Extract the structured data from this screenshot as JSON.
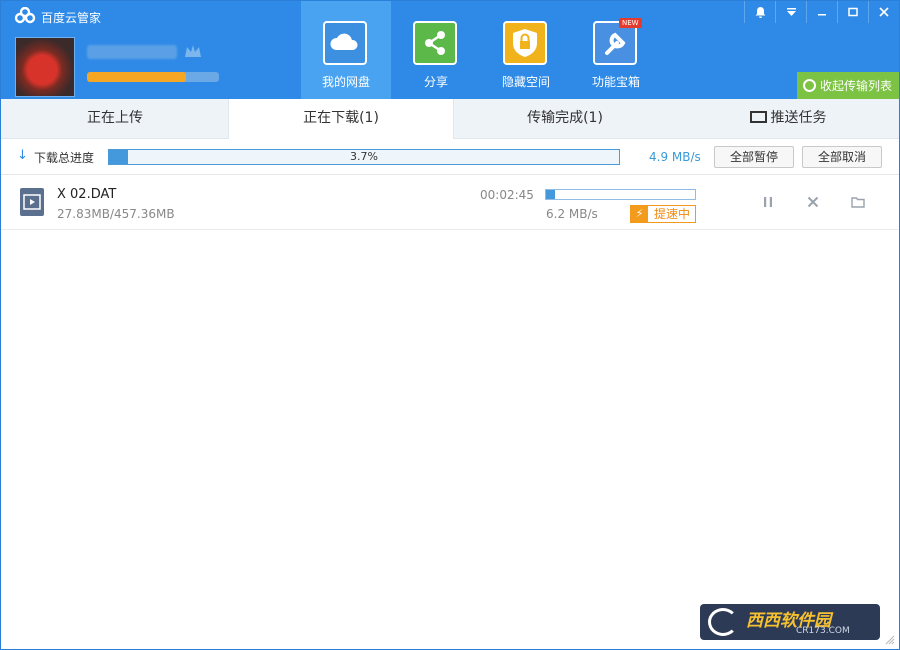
{
  "app": {
    "title": "百度云管家"
  },
  "user": {
    "level_progress": 0.75
  },
  "nav": [
    {
      "label": "我的网盘",
      "icon": "cloud-icon",
      "active": true
    },
    {
      "label": "分享",
      "icon": "share-icon"
    },
    {
      "label": "隐藏空间",
      "icon": "lock-icon"
    },
    {
      "label": "功能宝箱",
      "icon": "toolbox-icon",
      "badge": "NEW"
    }
  ],
  "collapse_button": "收起传输列表",
  "tabs": {
    "uploading": "正在上传",
    "downloading": "正在下载(1)",
    "completed": "传输完成(1)",
    "push": "推送任务"
  },
  "totals": {
    "label": "下载总进度",
    "percent_text": "3.7%",
    "progress": 0.037,
    "speed": "4.9 MB/s",
    "pause_all": "全部暂停",
    "cancel_all": "全部取消"
  },
  "task": {
    "name": "X  02.DAT",
    "size": "27.83MB/457.36MB",
    "time_left": "00:02:45",
    "progress": 0.061,
    "speed": "6.2 MB/s",
    "accel_label": "提速中"
  },
  "watermark": {
    "main": "西西软件园",
    "sub": "CR173.COM"
  },
  "colors": {
    "header": "#2e8ae6",
    "accent_green": "#7cc243",
    "progress": "#4499dd",
    "accel": "#f39b1c"
  }
}
